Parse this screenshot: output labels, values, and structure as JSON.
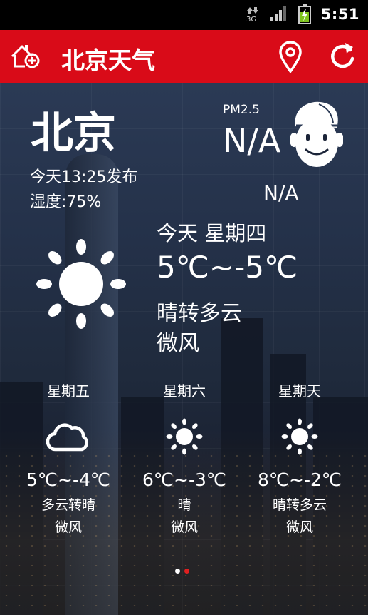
{
  "status_bar": {
    "network": "3G",
    "time": "5:51"
  },
  "title_bar": {
    "title": "北京天气"
  },
  "current": {
    "city": "北京",
    "publish_time": "今天13:25发布",
    "humidity": "湿度:75%",
    "pm25_label": "PM2.5",
    "pm25_value": "N/A",
    "air_quality": "N/A"
  },
  "today": {
    "day": "今天 星期四",
    "temp": "5℃~-5℃",
    "weather": "晴转多云",
    "wind": "微风",
    "icon": "sun-icon"
  },
  "forecast": [
    {
      "day": "星期五",
      "temp": "5℃~-4℃",
      "weather": "多云转晴",
      "wind": "微风",
      "icon": "cloud-icon"
    },
    {
      "day": "星期六",
      "temp": "6℃~-3℃",
      "weather": "晴",
      "wind": "微风",
      "icon": "sun-icon"
    },
    {
      "day": "星期天",
      "temp": "8℃~-2℃",
      "weather": "晴转多云",
      "wind": "微风",
      "icon": "sun-icon"
    }
  ],
  "pager": {
    "count": 2,
    "active": 2
  },
  "colors": {
    "accent": "#d90b18",
    "dot_active": "#e02020",
    "dot_inactive": "#ffffff"
  }
}
